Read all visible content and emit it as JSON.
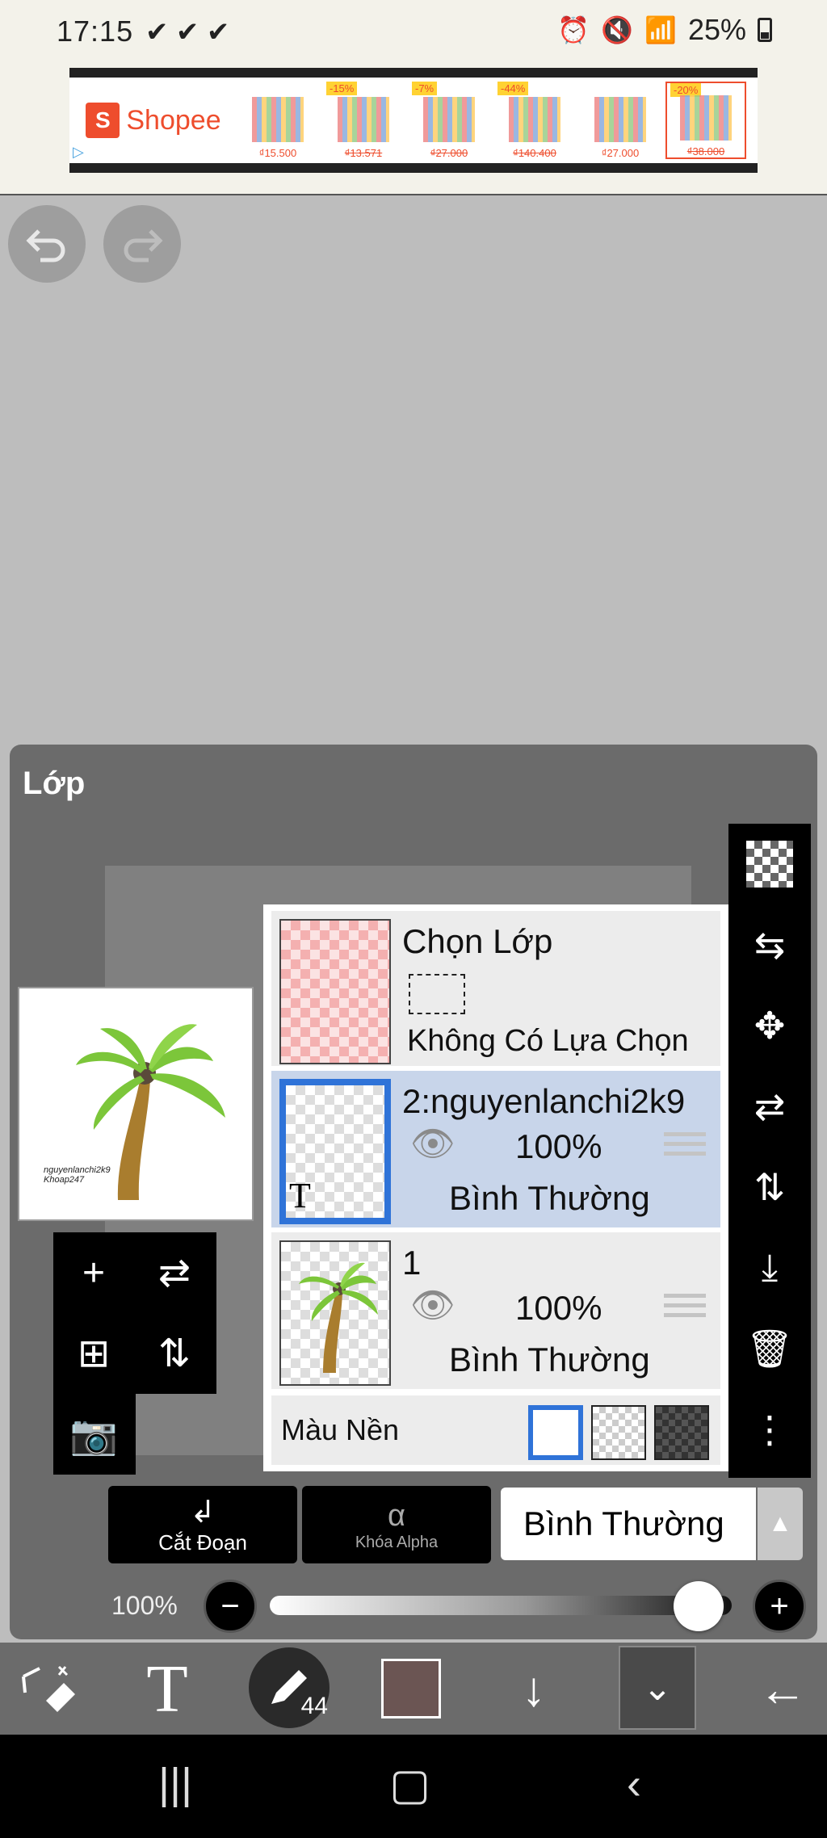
{
  "status": {
    "time": "17:15",
    "checks": "✔ ✔ ✔",
    "battery": "25%"
  },
  "ad": {
    "brand": "Shopee",
    "products": [
      {
        "discount": "",
        "price": "₫15.500",
        "old": false
      },
      {
        "discount": "-15%",
        "price": "₫13.571",
        "old": true
      },
      {
        "discount": "-7%",
        "price": "₫27.000",
        "old": true
      },
      {
        "discount": "-44%",
        "price": "₫140.400",
        "old": true
      },
      {
        "discount": "",
        "price": "₫27.000",
        "old": false
      },
      {
        "discount": "-20%",
        "price": "₫38.000",
        "old": true
      }
    ]
  },
  "panel": {
    "title": "Lớp",
    "selection_layer": {
      "title": "Chọn Lớp",
      "subtitle": "Không Có Lựa Chọn"
    },
    "layers": [
      {
        "name": "2:nguyenlanchi2k9",
        "opacity": "100%",
        "blend": "Bình Thường",
        "active": true
      },
      {
        "name": "1",
        "opacity": "100%",
        "blend": "Bình Thường",
        "active": false
      }
    ],
    "background": {
      "label": "Màu Nền"
    },
    "actions": {
      "clip_label": "Cắt Đoạn",
      "alpha_lock_label": "Khóa Alpha",
      "alpha_icon": "α"
    },
    "blend_mode": "Bình Thường",
    "opacity_label": "100%",
    "opacity_value": 1.0
  },
  "toolbar": {
    "brush_size": "44",
    "color": "#6b5553",
    "text_tool": "T"
  },
  "icons": {
    "undo": "undo-icon",
    "redo": "redo-icon",
    "eye": "eye-icon",
    "add_layer": "plus-icon",
    "flip_h": "flip-horizontal-icon"
  }
}
